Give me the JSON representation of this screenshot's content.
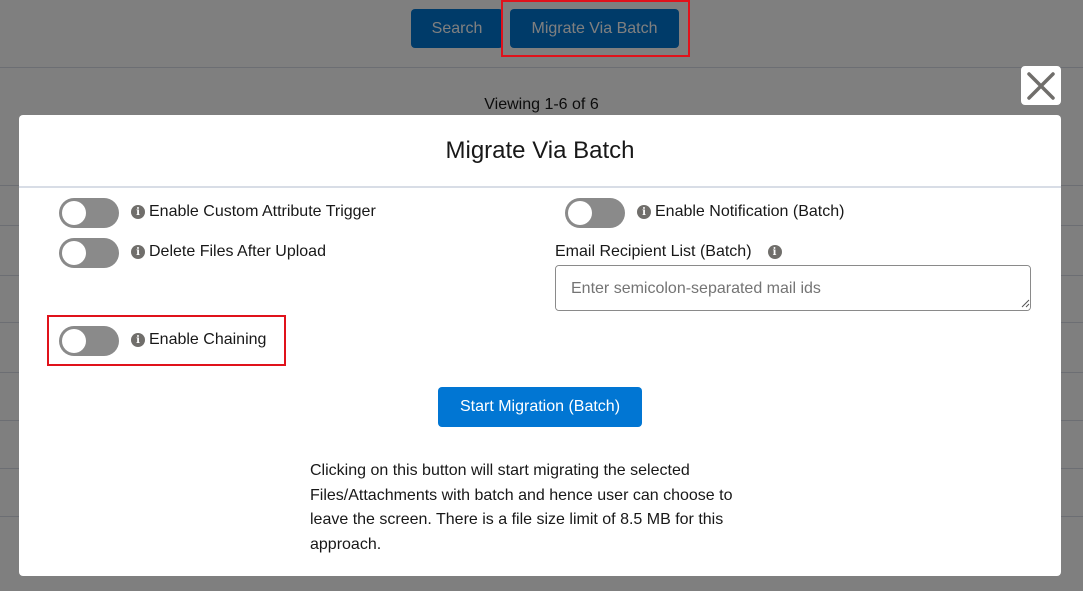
{
  "background": {
    "toolbar": {
      "search_label": "Search",
      "migrate_label": "Migrate Via Batch"
    },
    "viewing_text": "Viewing 1-6 of 6"
  },
  "modal": {
    "title": "Migrate Via Batch",
    "options": {
      "custom_attribute_trigger": {
        "label": "Enable Custom Attribute Trigger",
        "enabled": false
      },
      "delete_files": {
        "label": "Delete Files After Upload",
        "enabled": false
      },
      "notification": {
        "label": "Enable Notification (Batch)",
        "enabled": false
      },
      "chaining": {
        "label": "Enable Chaining",
        "enabled": false
      }
    },
    "email": {
      "label": "Email Recipient List (Batch)",
      "placeholder": "Enter semicolon-separated mail ids",
      "value": ""
    },
    "start_button_label": "Start Migration (Batch)",
    "description": "Clicking on this button will start migrating the selected Files/Attachments with batch and hence user can choose to leave the screen. There is a file size limit of 8.5 MB for this approach."
  },
  "icons": {
    "close": "close-icon",
    "info": "info-icon"
  },
  "colors": {
    "brand": "#0176d3",
    "highlight": "#e0121b",
    "toggle_off": "#8a8a8a"
  }
}
